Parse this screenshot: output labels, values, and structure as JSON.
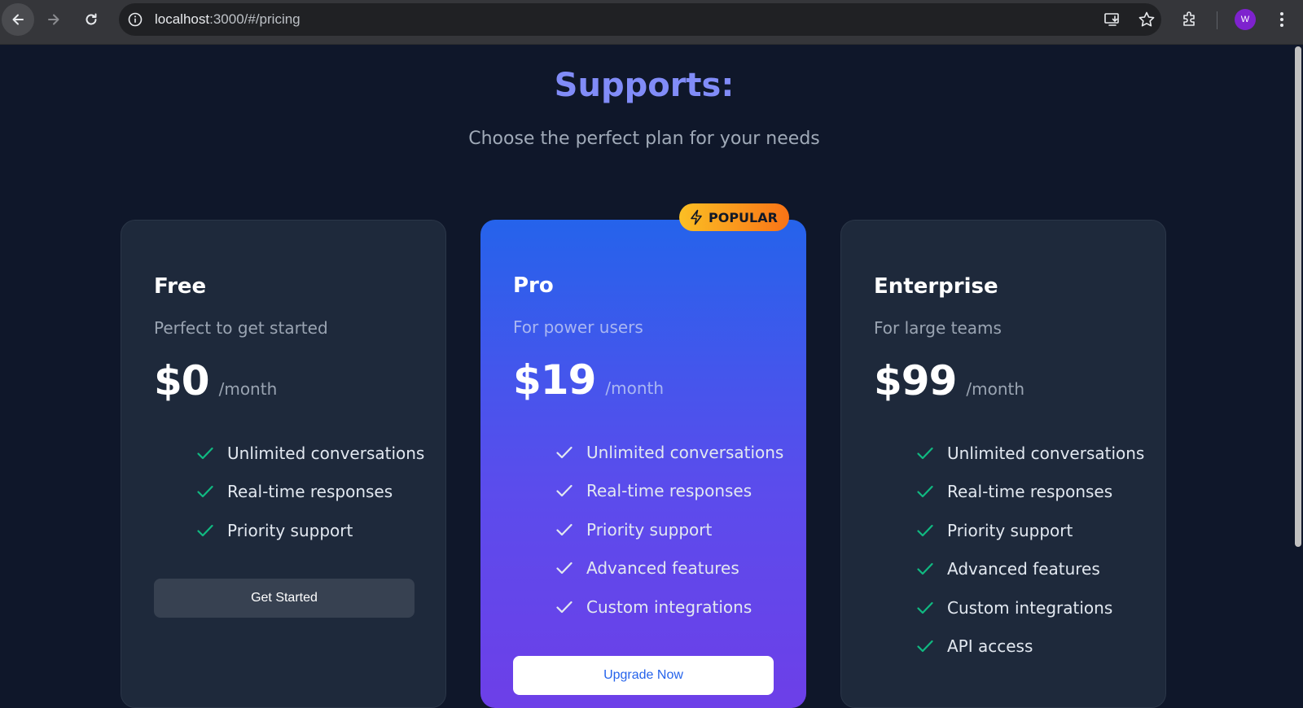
{
  "browser": {
    "url_host": "localhost",
    "url_path": ":3000/#/pricing",
    "avatar_initial": "W"
  },
  "page": {
    "title": "Supports:",
    "subtitle": "Choose the perfect plan for your needs"
  },
  "badge": {
    "label": "POPULAR",
    "icon": "lightning-icon"
  },
  "plans": [
    {
      "name": "Free",
      "description": "Perfect to get started",
      "price": "$0",
      "period": "/month",
      "features": [
        "Unlimited conversations",
        "Real-time responses",
        "Priority support"
      ],
      "cta": "Get Started"
    },
    {
      "name": "Pro",
      "description": "For power users",
      "price": "$19",
      "period": "/month",
      "features": [
        "Unlimited conversations",
        "Real-time responses",
        "Priority support",
        "Advanced features",
        "Custom integrations"
      ],
      "cta": "Upgrade Now"
    },
    {
      "name": "Enterprise",
      "description": "For large teams",
      "price": "$99",
      "period": "/month",
      "features": [
        "Unlimited conversations",
        "Real-time responses",
        "Priority support",
        "Advanced features",
        "Custom integrations",
        "API access"
      ]
    }
  ],
  "colors": {
    "background": "#0f172a",
    "card": "#1e293b",
    "title": "#818cf8",
    "check": "#10b981",
    "pro_gradient_start": "#2563eb",
    "pro_gradient_end": "#6d3fe8",
    "badge_start": "#fbbf24",
    "badge_end": "#f97316"
  }
}
